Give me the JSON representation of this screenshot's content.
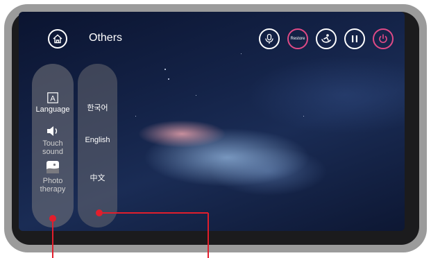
{
  "header": {
    "title": "Others",
    "restore_label": "Restore"
  },
  "sidebar": {
    "items": [
      {
        "label": "Language",
        "icon": "language-icon",
        "active": true
      },
      {
        "label": "Touch sound",
        "icon": "speaker-icon",
        "active": false
      },
      {
        "label": "Photo therapy",
        "icon": "photo-therapy-icon",
        "active": false
      }
    ]
  },
  "languages": [
    "한국어",
    "English",
    "中文"
  ],
  "colors": {
    "accent": "#e04a86",
    "callout": "#e21e2c",
    "frame": "#9b9b9b"
  }
}
